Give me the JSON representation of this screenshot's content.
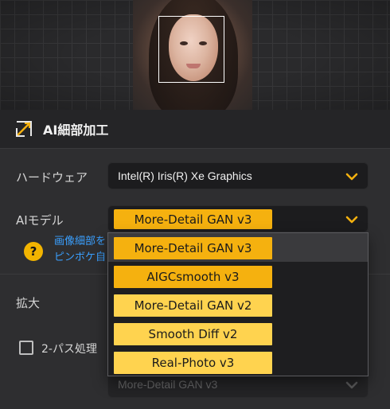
{
  "preview": {
    "face_detected": true
  },
  "section": {
    "title": "AI細部加工",
    "icon": "ai-detail-icon"
  },
  "hardware": {
    "label": "ハードウェア",
    "value": "Intel(R) Iris(R) Xe Graphics"
  },
  "ai_model": {
    "label": "AIモデル",
    "value": "More-Detail GAN  v3"
  },
  "note": {
    "line1": "画像細部を",
    "line2": "ピンボケ自"
  },
  "upscale": {
    "label": "拡大"
  },
  "two_pass": {
    "label": "2-パス処理",
    "checked": false
  },
  "second_model": {
    "value": "More-Detail GAN  v3"
  },
  "dropdown": {
    "options": [
      {
        "label": "More-Detail GAN  v3",
        "highlighted": true
      },
      {
        "label": "AIGCsmooth  v3",
        "highlighted": false
      },
      {
        "label": "More-Detail GAN  v2",
        "highlighted": false
      },
      {
        "label": "Smooth Diff  v2",
        "highlighted": false
      },
      {
        "label": "Real-Photo  v3",
        "highlighted": false
      }
    ]
  },
  "colors": {
    "accent": "#f5b10f",
    "accent_light": "#ffd34f",
    "link": "#3aa0ff",
    "panel": "#2e2e30"
  }
}
